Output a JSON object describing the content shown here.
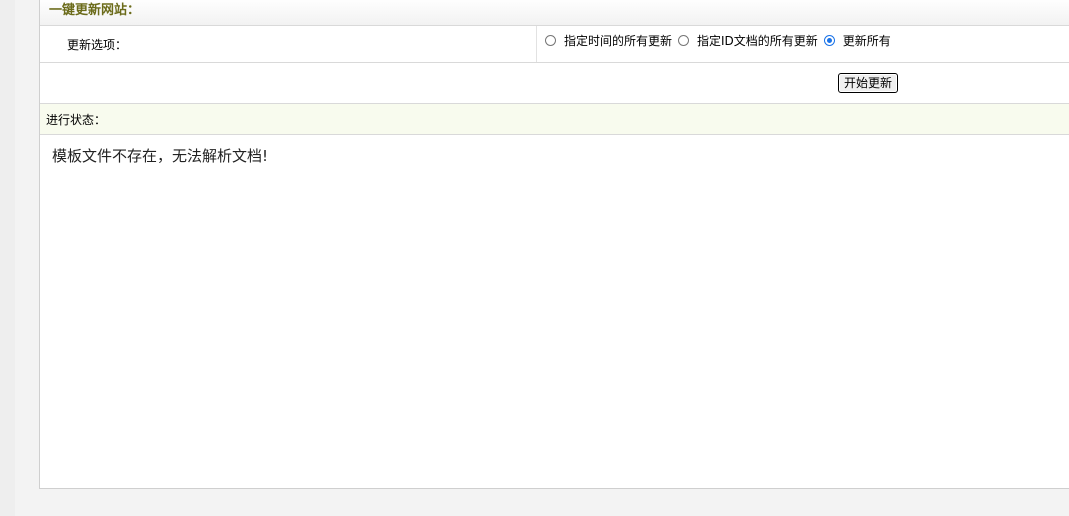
{
  "header": {
    "title": "一键更新网站："
  },
  "options": {
    "label": "更新选项：",
    "radios": [
      {
        "label": "指定时间的所有更新",
        "checked": false
      },
      {
        "label": "指定ID文档的所有更新",
        "checked": false
      },
      {
        "label": "更新所有",
        "checked": true
      }
    ]
  },
  "actions": {
    "start_label": "开始更新"
  },
  "status": {
    "label": "进行状态：",
    "message": "模板文件不存在，无法解析文档!"
  },
  "colors": {
    "title": "#6b6b1a",
    "status_bg": "#f8fbee",
    "radio_checked": "#1a73e8"
  }
}
